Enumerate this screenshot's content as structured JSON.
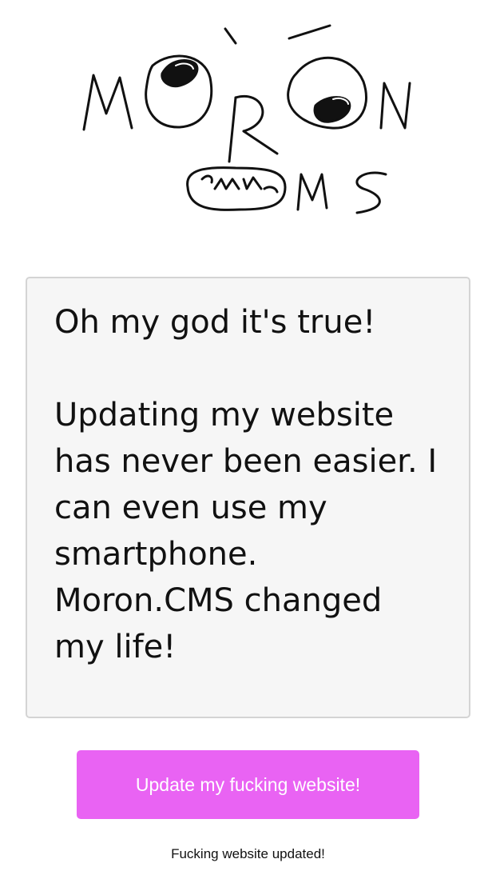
{
  "logo": {
    "text": "MORON CMS"
  },
  "editor": {
    "value": "Oh my god it's true!\n\nUpdating my website has never been easier. I can even use my smartphone. Moron.CMS changed my life!"
  },
  "update_button": {
    "label": "Update my fucking website!"
  },
  "status": {
    "message": "Fucking website updated!"
  },
  "colors": {
    "button_background": "#e963f3",
    "editor_background": "#f6f6f6",
    "editor_border": "#d4d4d4"
  }
}
